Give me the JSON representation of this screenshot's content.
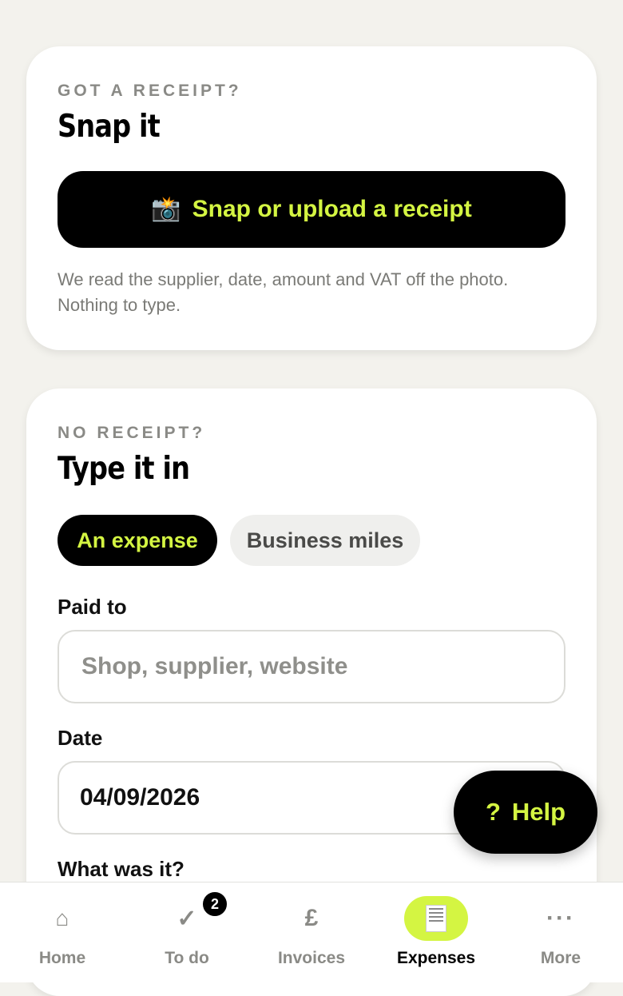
{
  "receipt_card": {
    "eyebrow": "GOT A RECEIPT?",
    "title": "Snap it",
    "button_icon": "📸",
    "button_label": "Snap or upload a receipt",
    "hint": "We read the supplier, date, amount and VAT off the photo. Nothing to type."
  },
  "manual_card": {
    "eyebrow": "NO RECEIPT?",
    "title": "Type it in",
    "toggle": [
      "An expense",
      "Business miles"
    ],
    "selected_toggle": "An expense",
    "paid_to_label": "Paid to",
    "paid_to_placeholder": "Shop, supplier, website",
    "paid_to_value": "",
    "date_label": "Date",
    "date_value": "04/09/2026",
    "what_label": "What was it?"
  },
  "help": {
    "icon": "?",
    "label": "Help"
  },
  "nav": {
    "items": [
      {
        "label": "Home",
        "icon": "⌂",
        "icon_name": "home-icon"
      },
      {
        "label": "To do",
        "icon": "✓",
        "icon_name": "checkmark-icon",
        "badge": "2"
      },
      {
        "label": "Invoices",
        "icon": "£",
        "icon_name": "pound-icon"
      },
      {
        "label": "Expenses",
        "icon": "receipt",
        "icon_name": "receipt-icon"
      },
      {
        "label": "More",
        "icon": "···",
        "icon_name": "more-icon"
      }
    ],
    "active": "Expenses"
  },
  "colors": {
    "accent": "#d4f542",
    "background": "#f3f2ed",
    "dark": "#000000"
  }
}
